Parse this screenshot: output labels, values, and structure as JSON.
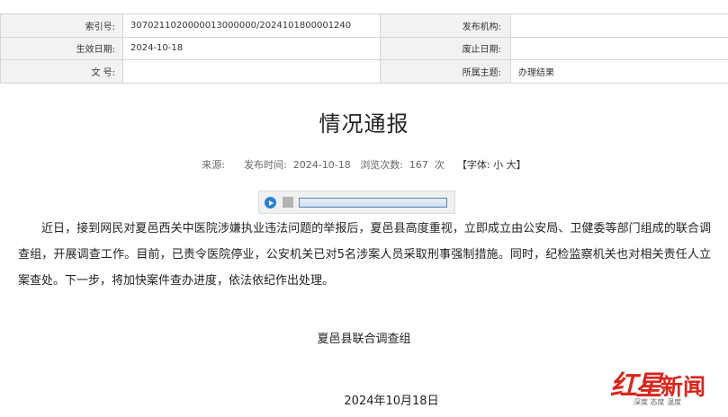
{
  "meta": {
    "index_label": "索引号:",
    "index_value": "3070211020000013000000/2024101800001240",
    "publisher_label": "发布机构:",
    "publisher_value": "",
    "effective_label": "生效日期:",
    "effective_value": "2024-10-18",
    "expire_label": "废止日期:",
    "expire_value": "",
    "docno_label": "文 号:",
    "docno_value": "",
    "topic_label": "所属主题:",
    "topic_value": "办理结果"
  },
  "article": {
    "title": "情况通报",
    "source_label": "来源:",
    "publish_time": "发布时间:  2024-10-18",
    "views": "浏览次数:  167  次",
    "font_size_open": "【字体:",
    "font_small": "小",
    "font_large": "大",
    "font_size_close": "】",
    "body": "近日，接到网民对夏邑西关中医院涉嫌执业违法问题的举报后，夏邑县高度重视，立即成立由公安局、卫健委等部门组成的联合调查组，开展调查工作。目前，已责令医院停业，公安机关已对5名涉案人员采取刑事强制措施。同时，纪检监察机关也对相关责任人立案查处。下一步，将加快案件查办进度，依法依纪作出处理。",
    "signature": "夏邑县联合调查组",
    "date": "2024年10月18日"
  },
  "watermark": {
    "name": "红星新闻",
    "name_part1": "红星",
    "name_part2": "新闻",
    "slogan": "深度 态度 温度",
    "color": "#d8261d"
  },
  "player": {
    "accent_color": "#2d7fd3"
  }
}
